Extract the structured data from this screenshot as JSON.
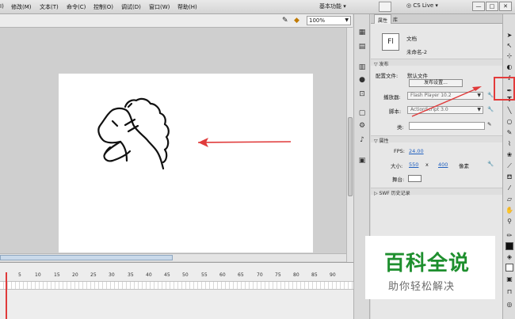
{
  "menubar": {
    "items": [
      "I)",
      "修改(M)",
      "文本(T)",
      "命令(C)",
      "控制(O)",
      "调试(D)",
      "窗口(W)",
      "帮助(H)"
    ],
    "workspace": "基本功能 ▾",
    "cs_live": "CS Live",
    "window_buttons": [
      "—",
      "□",
      "✕"
    ]
  },
  "editbar": {
    "zoom": "100%"
  },
  "timeline": {
    "ruler": [
      "5",
      "10",
      "15",
      "20",
      "25",
      "30",
      "35",
      "40",
      "45",
      "50",
      "55",
      "60",
      "65",
      "70",
      "75",
      "80",
      "85",
      "90"
    ]
  },
  "properties": {
    "tabs": [
      "属性",
      "库"
    ],
    "doc_icon": "Fl",
    "doc_type": "文档",
    "doc_name": "未命名-2",
    "publish_section": "发布",
    "profile_label": "配置文件:",
    "profile_value": "默认文件",
    "publish_settings_button": "发布设置...",
    "player_label": "播放器:",
    "player_value": "Flash Player 10.2",
    "script_label": "脚本:",
    "script_value": "ActionScript 3.0",
    "class_label": "类:",
    "properties_section": "属性",
    "fps_label": "FPS:",
    "fps_value": "24.00",
    "size_label": "大小:",
    "width_value": "550",
    "x_sep": "x",
    "height_value": "400",
    "unit": "像素",
    "stage_label": "舞台:",
    "history_section": "SWF 历史记录"
  },
  "watermark": {
    "title": "百科全说",
    "subtitle": "助你轻松解决"
  },
  "colors": {
    "arrow": "#e03a3a",
    "link": "#1f5fbf",
    "watermark_green": "#1e8f2e"
  }
}
